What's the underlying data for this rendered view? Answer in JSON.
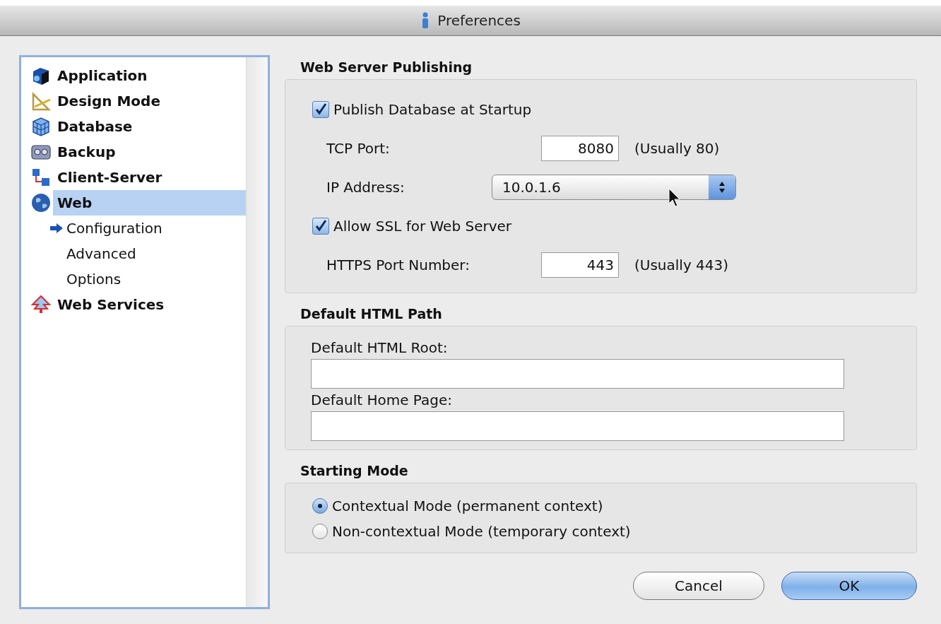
{
  "window": {
    "title": "Preferences"
  },
  "sidebar": {
    "items": [
      {
        "label": "Application",
        "selected": false
      },
      {
        "label": "Design Mode",
        "selected": false
      },
      {
        "label": "Database",
        "selected": false
      },
      {
        "label": "Backup",
        "selected": false
      },
      {
        "label": "Client-Server",
        "selected": false
      },
      {
        "label": "Web",
        "selected": true,
        "children": [
          {
            "label": "Configuration",
            "selected": true
          },
          {
            "label": "Advanced",
            "selected": false
          },
          {
            "label": "Options",
            "selected": false
          }
        ]
      },
      {
        "label": "Web Services",
        "selected": false
      }
    ]
  },
  "sections": [
    {
      "title": "Web Server Publishing",
      "rows": [
        {
          "kind": "checkbox",
          "label": "Publish Database at Startup",
          "checked": true
        },
        {
          "kind": "field",
          "label": "TCP Port:",
          "value": "8080",
          "hint": "(Usually 80)"
        },
        {
          "kind": "select",
          "label": "IP Address:",
          "value": "10.0.1.6"
        },
        {
          "kind": "checkbox",
          "label": "Allow SSL for Web Server",
          "checked": true
        },
        {
          "kind": "field",
          "label": "HTTPS Port Number:",
          "value": "443",
          "hint": "(Usually 443)"
        }
      ]
    },
    {
      "title": "Default HTML Path",
      "rows": [
        {
          "kind": "wide",
          "label": "Default HTML Root:"
        },
        {
          "kind": "wide",
          "label": "Default Home Page:"
        }
      ]
    },
    {
      "title": "Starting Mode",
      "rows": [
        {
          "kind": "radio",
          "label": "Contextual Mode (permanent context)",
          "selected": true
        },
        {
          "kind": "radio",
          "label": "Non-contextual Mode (temporary context)",
          "selected": false
        }
      ]
    }
  ],
  "buttons": [
    {
      "label": "Cancel",
      "kind": "normal"
    },
    {
      "label": "OK",
      "kind": "default"
    }
  ]
}
